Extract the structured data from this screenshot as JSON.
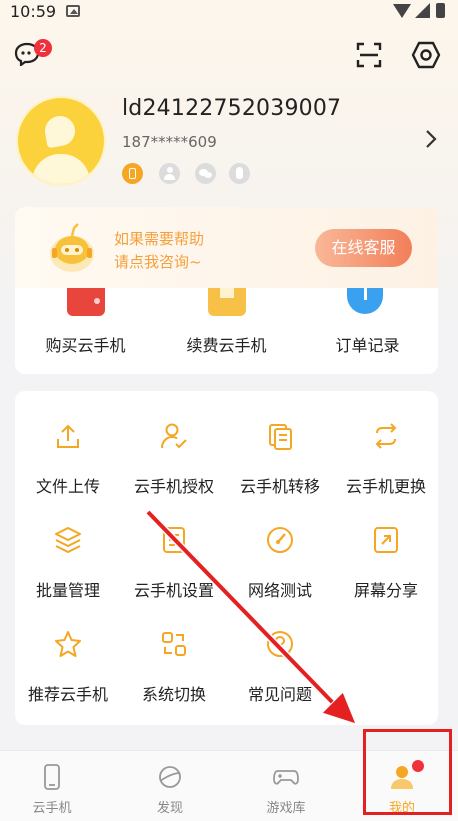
{
  "status_bar": {
    "time": "10:59"
  },
  "header": {
    "message_badge": "2"
  },
  "profile": {
    "username": "ld24122752039007",
    "phone": "187*****609"
  },
  "help_banner": {
    "line1": "如果需要帮助",
    "line2": "请点我咨询~",
    "button": "在线客服"
  },
  "card_actions": [
    {
      "label": "购买云手机",
      "icon": "wallet-icon"
    },
    {
      "label": "续费云手机",
      "icon": "renew-box-icon"
    },
    {
      "label": "订单记录",
      "icon": "clock-icon"
    }
  ],
  "tools": [
    {
      "label": "文件上传",
      "icon": "upload-icon"
    },
    {
      "label": "云手机授权",
      "icon": "authorize-user-icon"
    },
    {
      "label": "云手机转移",
      "icon": "transfer-icon"
    },
    {
      "label": "云手机更换",
      "icon": "swap-icon"
    },
    {
      "label": "批量管理",
      "icon": "layers-icon"
    },
    {
      "label": "云手机设置",
      "icon": "phone-settings-icon"
    },
    {
      "label": "网络测试",
      "icon": "speedometer-icon"
    },
    {
      "label": "屏幕分享",
      "icon": "share-screen-icon"
    },
    {
      "label": "推荐云手机",
      "icon": "star-icon"
    },
    {
      "label": "系统切换",
      "icon": "switch-icon"
    },
    {
      "label": "常见问题",
      "icon": "faq-icon"
    }
  ],
  "bottom_nav": [
    {
      "label": "云手机",
      "icon": "phone-icon"
    },
    {
      "label": "发现",
      "icon": "planet-icon"
    },
    {
      "label": "游戏库",
      "icon": "gamepad-icon"
    },
    {
      "label": "我的",
      "icon": "me-icon"
    }
  ],
  "colors": {
    "accent": "#f5a623",
    "banner_button": "#f27f5a",
    "badge": "#f0303a",
    "annotation": "#e52020"
  }
}
